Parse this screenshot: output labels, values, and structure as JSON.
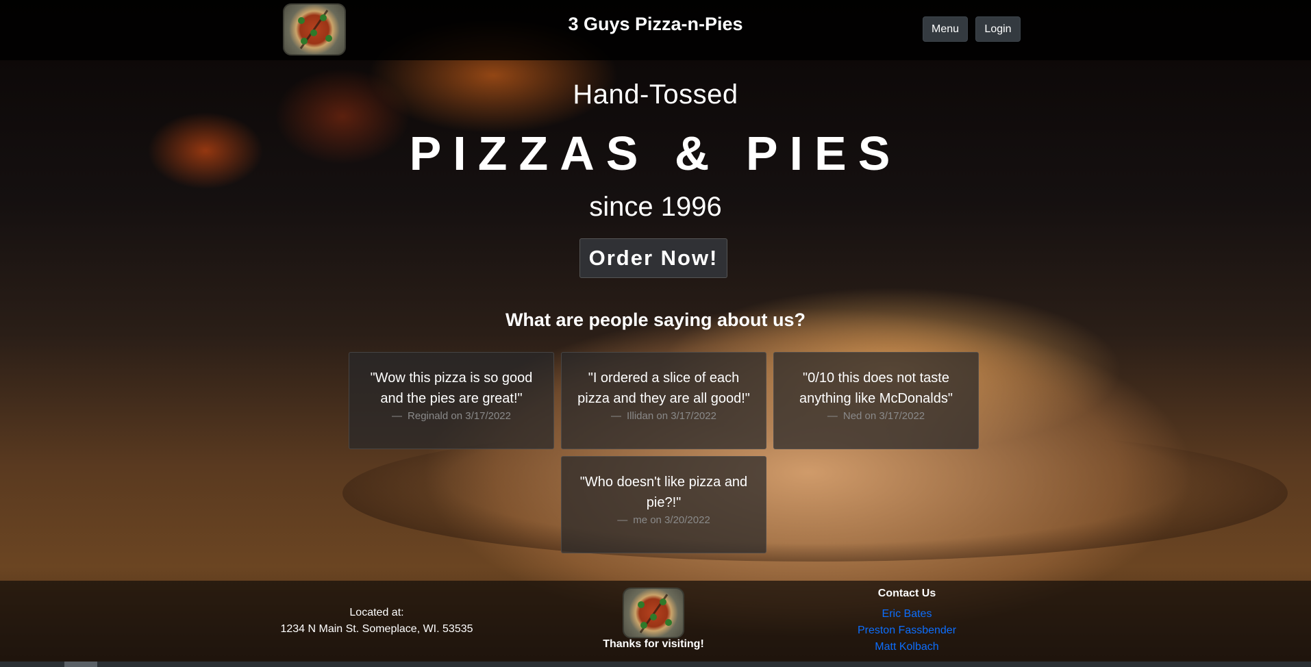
{
  "header": {
    "title": "3 Guys Pizza-n-Pies",
    "menu_label": "Menu",
    "login_label": "Login"
  },
  "hero": {
    "subtitle": "Hand-Tossed",
    "headline": "PIZZAS & PIES",
    "since": "since 1996",
    "cta_label": "Order Now!"
  },
  "reviews": {
    "heading": "What are people saying about us?",
    "items": [
      {
        "quote": "\"Wow this pizza is so good and the pies are great!\"",
        "author": "Reginald on 3/17/2022"
      },
      {
        "quote": "\"I ordered a slice of each pizza and they are all good!\"",
        "author": "Illidan on 3/17/2022"
      },
      {
        "quote": "\"0/10 this does not taste anything like McDonalds\"",
        "author": "Ned on 3/17/2022"
      },
      {
        "quote": "\"Who doesn't like pizza and pie?!\"",
        "author": "me on 3/20/2022"
      }
    ],
    "dash": "—"
  },
  "footer": {
    "location_label": "Located at:",
    "address": "1234 N Main St. Someplace, WI. 53535",
    "thanks": "Thanks for visiting!",
    "contact_title": "Contact Us",
    "contacts": [
      "Eric Bates",
      "Preston Fassbender",
      "Matt Kolbach"
    ]
  },
  "colors": {
    "link": "#0d6efd",
    "button_bg": "#343a40"
  },
  "icons": {
    "logo": "pizza-logo-icon"
  }
}
